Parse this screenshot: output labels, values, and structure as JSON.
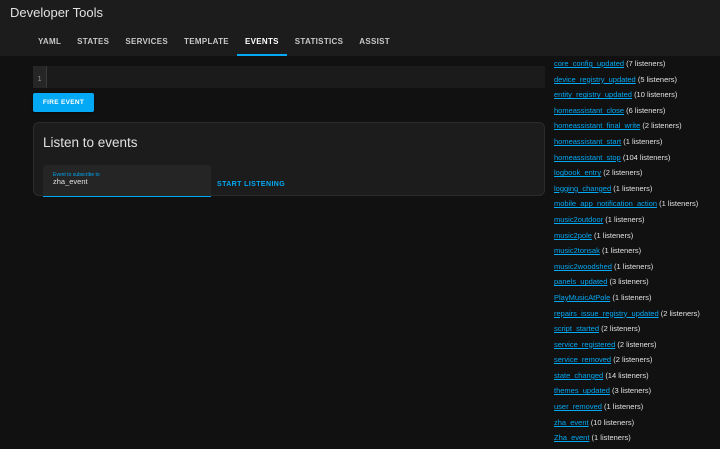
{
  "header": {
    "title": "Developer Tools",
    "tabs": [
      {
        "label": "YAML",
        "active": false
      },
      {
        "label": "STATES",
        "active": false
      },
      {
        "label": "SERVICES",
        "active": false
      },
      {
        "label": "TEMPLATE",
        "active": false
      },
      {
        "label": "EVENTS",
        "active": true
      },
      {
        "label": "STATISTICS",
        "active": false
      },
      {
        "label": "ASSIST",
        "active": false
      }
    ]
  },
  "fire": {
    "line_number": "1",
    "button_label": "FIRE EVENT"
  },
  "listen": {
    "title": "Listen to events",
    "field_label": "Event to subscribe to",
    "field_value": "zha_event",
    "start_label": "START LISTENING"
  },
  "listeners": [
    {
      "event": "core_config_updated",
      "count": "(7 listeners)"
    },
    {
      "event": "device_registry_updated",
      "count": "(5 listeners)"
    },
    {
      "event": "entity_registry_updated",
      "count": "(10 listeners)"
    },
    {
      "event": "homeassistant_close",
      "count": "(6 listeners)"
    },
    {
      "event": "homeassistant_final_write",
      "count": "(2 listeners)"
    },
    {
      "event": "homeassistant_start",
      "count": "(1 listeners)"
    },
    {
      "event": "homeassistant_stop",
      "count": "(104 listeners)"
    },
    {
      "event": "logbook_entry",
      "count": "(2 listeners)"
    },
    {
      "event": "logging_changed",
      "count": "(1 listeners)"
    },
    {
      "event": "mobile_app_notification_action",
      "count": "(1 listeners)"
    },
    {
      "event": "music2outdoor",
      "count": "(1 listeners)"
    },
    {
      "event": "music2pole",
      "count": "(1 listeners)"
    },
    {
      "event": "music2tonsak",
      "count": "(1 listeners)"
    },
    {
      "event": "music2woodshed",
      "count": "(1 listeners)"
    },
    {
      "event": "panels_updated",
      "count": "(3 listeners)"
    },
    {
      "event": "PlayMusicAtPole",
      "count": "(1 listeners)"
    },
    {
      "event": "repairs_issue_registry_updated",
      "count": "(2 listeners)"
    },
    {
      "event": "script_started",
      "count": "(2 listeners)"
    },
    {
      "event": "service_registered",
      "count": "(2 listeners)"
    },
    {
      "event": "service_removed",
      "count": "(2 listeners)"
    },
    {
      "event": "state_changed",
      "count": "(14 listeners)"
    },
    {
      "event": "themes_updated",
      "count": "(3 listeners)"
    },
    {
      "event": "user_removed",
      "count": "(1 listeners)"
    },
    {
      "event": "zha_event",
      "count": "(10 listeners)"
    },
    {
      "event": "Zha_event",
      "count": "(1 listeners)"
    }
  ],
  "colors": {
    "accent": "#03a9f4",
    "background": "#111111",
    "card": "#1c1c1c"
  }
}
